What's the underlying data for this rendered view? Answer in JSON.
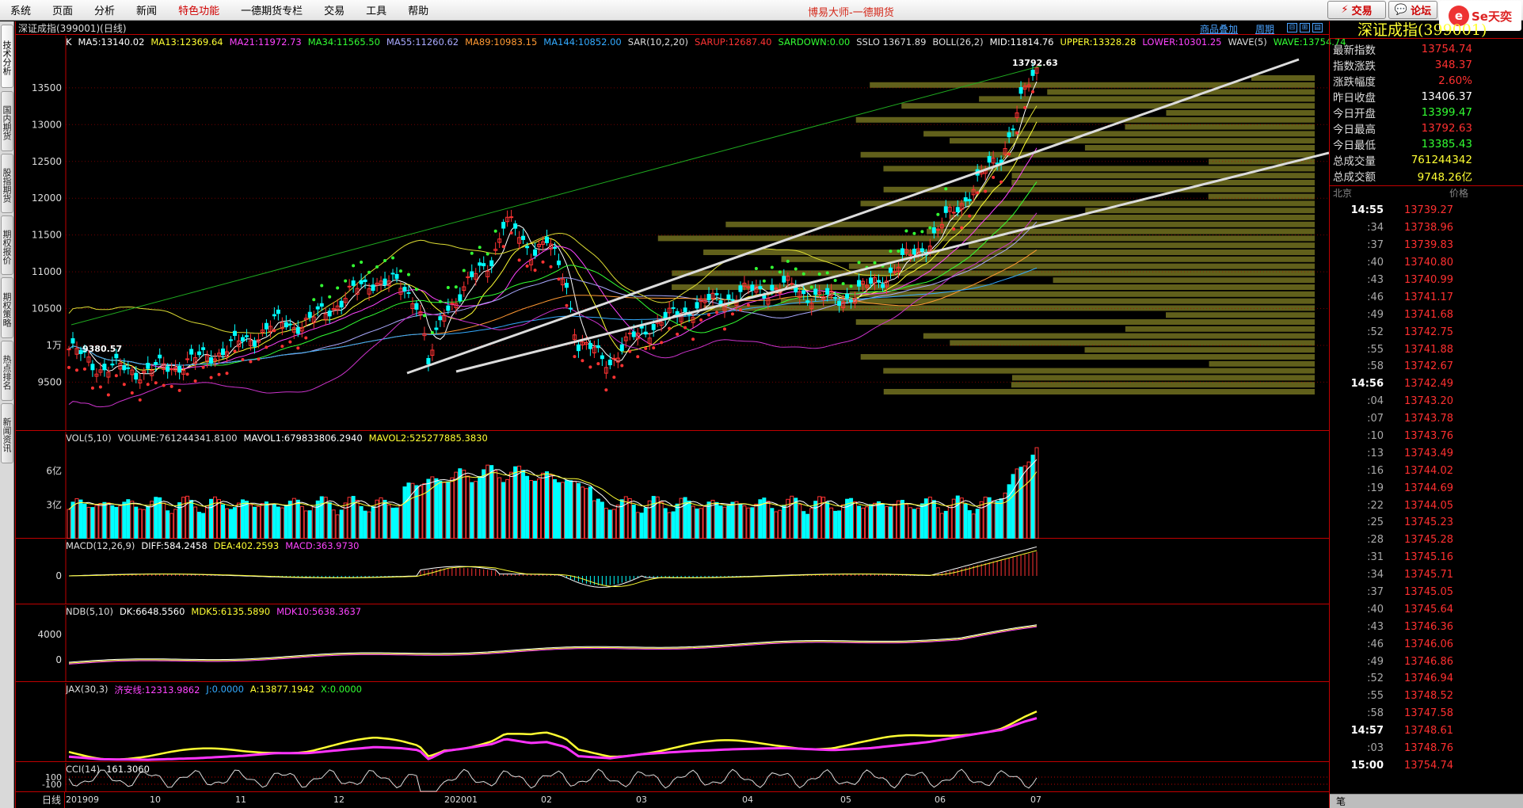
{
  "menu": [
    "系统",
    "页面",
    "分析",
    "新闻",
    "特色功能",
    "一德期货专栏",
    "交易",
    "工具",
    "帮助"
  ],
  "menu_highlight": "特色功能",
  "app_title": "博易大师-一德期货",
  "trade_button": "交易",
  "forum_button": "论坛",
  "logo": {
    "mark": "e",
    "text": "Se天奕"
  },
  "left_tabs": [
    "技术分析",
    "国内期货",
    "股指期货",
    "期权报价",
    "期权策略",
    "热点排名",
    "新闻资讯"
  ],
  "toolbar": {
    "title": "深证成指(399001)(日线)",
    "compare": "商品叠加",
    "period": "周期"
  },
  "indicators": {
    "main": [
      {
        "text": "K",
        "color": "#ffffff"
      },
      {
        "text": "MA5:13140.02",
        "color": "#ffffff"
      },
      {
        "text": "MA13:12369.64",
        "color": "#ffff33"
      },
      {
        "text": "MA21:11972.73",
        "color": "#ff44ff"
      },
      {
        "text": "MA34:11565.50",
        "color": "#33ff33"
      },
      {
        "text": "MA55:11260.62",
        "color": "#aaaaff"
      },
      {
        "text": "MA89:10983.15",
        "color": "#ff9933"
      },
      {
        "text": "MA144:10852.00",
        "color": "#33aaff"
      },
      {
        "text": "SAR(10,2,20)",
        "color": "#dddddd"
      },
      {
        "text": "SARUP:12687.40",
        "color": "#ff3333"
      },
      {
        "text": "SARDOWN:0.00",
        "color": "#33ff33"
      },
      {
        "text": "SSLO 13671.89",
        "color": "#dddddd"
      },
      {
        "text": "BOLL(26,2)",
        "color": "#dddddd"
      },
      {
        "text": "MID:11814.76",
        "color": "#ffffff"
      },
      {
        "text": "UPPER:13328.28",
        "color": "#ffff33"
      },
      {
        "text": "LOWER:10301.25",
        "color": "#ff44ff"
      },
      {
        "text": "WAVE(5)",
        "color": "#dddddd"
      },
      {
        "text": "WAVE:13754.74",
        "color": "#33ff33"
      }
    ],
    "vol": [
      {
        "text": "VOL(5,10)",
        "color": "#dddddd"
      },
      {
        "text": "VOLUME:761244341.8100",
        "color": "#dddddd"
      },
      {
        "text": "MAVOL1:679833806.2940",
        "color": "#ffffff"
      },
      {
        "text": "MAVOL2:525277885.3830",
        "color": "#ffff33"
      }
    ],
    "macd": [
      {
        "text": "MACD(12,26,9)",
        "color": "#dddddd"
      },
      {
        "text": "DIFF:584.2458",
        "color": "#ffffff"
      },
      {
        "text": "DEA:402.2593",
        "color": "#ffff33"
      },
      {
        "text": "MACD:363.9730",
        "color": "#ff44ff"
      }
    ],
    "ndb": [
      {
        "text": "NDB(5,10)",
        "color": "#dddddd"
      },
      {
        "text": "DK:6648.5560",
        "color": "#ffffff"
      },
      {
        "text": "MDK5:6135.5890",
        "color": "#ffff33"
      },
      {
        "text": "MDK10:5638.3637",
        "color": "#ff44ff"
      }
    ],
    "jax": [
      {
        "text": "JAX(30,3)",
        "color": "#dddddd"
      },
      {
        "text": "济安线:12313.9862",
        "color": "#ff44ff"
      },
      {
        "text": "J:0.0000",
        "color": "#33aaff"
      },
      {
        "text": "A:13877.1942",
        "color": "#ffff33"
      },
      {
        "text": "X:0.0000",
        "color": "#33ff33"
      }
    ],
    "cci": [
      {
        "text": "CCI(14)",
        "color": "#dddddd"
      },
      {
        "text": "161.3060",
        "color": "#ffffff"
      }
    ]
  },
  "axes": {
    "main_ticks": [
      "13500",
      "13000",
      "12500",
      "12000",
      "11500",
      "11000",
      "10500",
      "1万",
      "9500"
    ],
    "vol_ticks": [
      "6亿",
      "3亿"
    ],
    "macd_ticks": [
      "0"
    ],
    "ndb_ticks": [
      "4000",
      "0"
    ],
    "cci_ticks": [
      "100",
      "-100"
    ],
    "x_period": "日线",
    "x_ticks": [
      "201909",
      "10",
      "11",
      "12",
      "202001",
      "02",
      "03",
      "04",
      "05",
      "06",
      "07"
    ]
  },
  "annotations": {
    "high": "13792.63",
    "low": "9380.57"
  },
  "colors": {
    "up": "#ff3333",
    "down": "#00ffff",
    "grid": "#c00000",
    "accent": "#ffff33"
  },
  "quote": {
    "name": "深证成指(399001)",
    "rows": [
      {
        "label": "最新指数",
        "value": "13754.74",
        "color": "#ff3030"
      },
      {
        "label": "指数涨跌",
        "value": "348.37",
        "color": "#ff3030"
      },
      {
        "label": "涨跌幅度",
        "value": "2.60%",
        "color": "#ff3030"
      },
      {
        "label": "昨日收盘",
        "value": "13406.37",
        "color": "#ffffff"
      },
      {
        "label": "今日开盘",
        "value": "13399.47",
        "color": "#33ff33"
      },
      {
        "label": "今日最高",
        "value": "13792.63",
        "color": "#ff3030"
      },
      {
        "label": "今日最低",
        "value": "13385.43",
        "color": "#33ff33"
      },
      {
        "label": "总成交量",
        "value": "761244342",
        "color": "#ffff33"
      },
      {
        "label": "总成交额",
        "value": "9748.26亿",
        "color": "#ffff33"
      }
    ]
  },
  "ticks_header": {
    "time": "北京",
    "price": "价格"
  },
  "ticks": [
    {
      "t": "14:55",
      "p": "13739.27",
      "bold": true
    },
    {
      "t": ":34",
      "p": "13738.96"
    },
    {
      "t": ":37",
      "p": "13739.83"
    },
    {
      "t": ":40",
      "p": "13740.80"
    },
    {
      "t": ":43",
      "p": "13740.99"
    },
    {
      "t": ":46",
      "p": "13741.17"
    },
    {
      "t": ":49",
      "p": "13741.68"
    },
    {
      "t": ":52",
      "p": "13742.75"
    },
    {
      "t": ":55",
      "p": "13741.88"
    },
    {
      "t": ":58",
      "p": "13742.67"
    },
    {
      "t": "14:56",
      "p": "13742.49",
      "bold": true
    },
    {
      "t": ":04",
      "p": "13743.20"
    },
    {
      "t": ":07",
      "p": "13743.78"
    },
    {
      "t": ":10",
      "p": "13743.76"
    },
    {
      "t": ":13",
      "p": "13743.49"
    },
    {
      "t": ":16",
      "p": "13744.02"
    },
    {
      "t": ":19",
      "p": "13744.69"
    },
    {
      "t": ":22",
      "p": "13744.05"
    },
    {
      "t": ":25",
      "p": "13745.23"
    },
    {
      "t": ":28",
      "p": "13745.28"
    },
    {
      "t": ":31",
      "p": "13745.16"
    },
    {
      "t": ":34",
      "p": "13745.71"
    },
    {
      "t": ":37",
      "p": "13745.05"
    },
    {
      "t": ":40",
      "p": "13745.64"
    },
    {
      "t": ":43",
      "p": "13746.36"
    },
    {
      "t": ":46",
      "p": "13746.06"
    },
    {
      "t": ":49",
      "p": "13746.86"
    },
    {
      "t": ":52",
      "p": "13746.94"
    },
    {
      "t": ":55",
      "p": "13748.52"
    },
    {
      "t": ":58",
      "p": "13747.58"
    },
    {
      "t": "14:57",
      "p": "13748.61",
      "bold": true
    },
    {
      "t": ":03",
      "p": "13748.76"
    },
    {
      "t": "15:00",
      "p": "13754.74",
      "bold": true
    }
  ],
  "footer_tab": "笔"
}
